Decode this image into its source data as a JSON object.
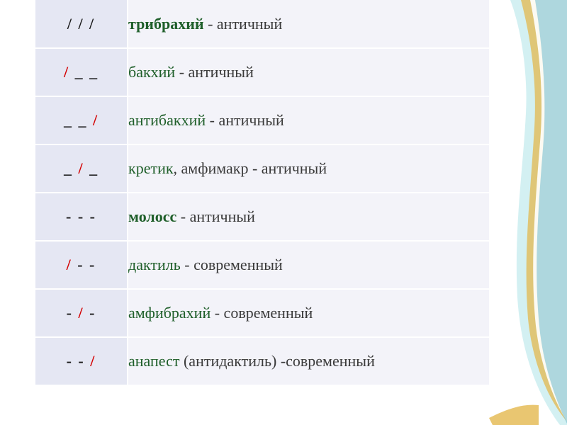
{
  "rows": [
    {
      "pattern_parts": [
        {
          "text": "/ / /",
          "cls": "blk"
        }
      ],
      "term": "трибрахий",
      "term_bold": true,
      "rest": " - античный"
    },
    {
      "pattern_parts": [
        {
          "text": "/",
          "cls": "red"
        },
        {
          "text": " _ _",
          "cls": "blk"
        }
      ],
      "term": "бакхий",
      "term_bold": false,
      "rest": " - античный"
    },
    {
      "pattern_parts": [
        {
          "text": "_ _  ",
          "cls": "blk"
        },
        {
          "text": "/",
          "cls": "red"
        }
      ],
      "term": "антибакхий",
      "term_bold": false,
      "rest": " - античный"
    },
    {
      "pattern_parts": [
        {
          "text": "_  ",
          "cls": "blk"
        },
        {
          "text": "/",
          "cls": "red"
        },
        {
          "text": "  _",
          "cls": "blk"
        }
      ],
      "term": "кретик",
      "term_bold": false,
      "rest": ", амфимакр - античный"
    },
    {
      "pattern_parts": [
        {
          "text": "-  -  -",
          "cls": "blk"
        }
      ],
      "term": "молосс",
      "term_bold": true,
      "rest": " - античный"
    },
    {
      "pattern_parts": [
        {
          "text": "/",
          "cls": "red"
        },
        {
          "text": " - -",
          "cls": "blk"
        }
      ],
      "term": "дактиль",
      "term_bold": false,
      "rest": " - современный"
    },
    {
      "pattern_parts": [
        {
          "text": "-  ",
          "cls": "blk"
        },
        {
          "text": "/",
          "cls": "red"
        },
        {
          "text": "  -",
          "cls": "blk"
        }
      ],
      "term": "амфибрахий",
      "term_bold": false,
      "rest": " - современный"
    },
    {
      "pattern_parts": [
        {
          "text": "-  -  ",
          "cls": "blk"
        },
        {
          "text": "/",
          "cls": "red"
        }
      ],
      "term": "анапест",
      "term_bold": false,
      "rest": " (антидактиль) -современный"
    }
  ]
}
